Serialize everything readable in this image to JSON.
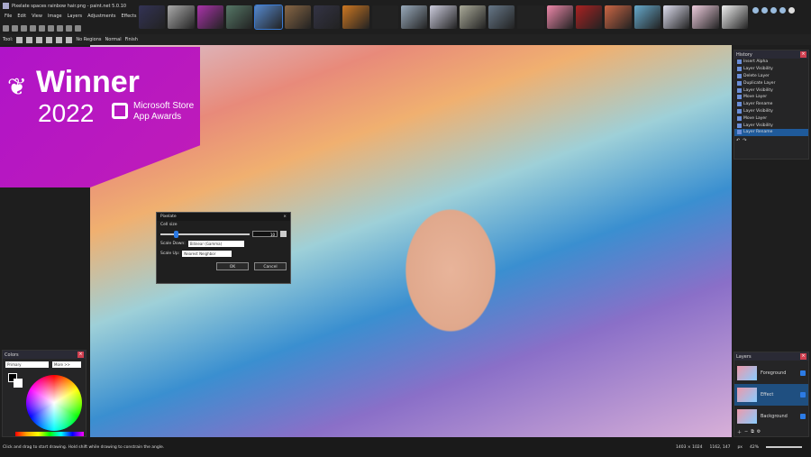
{
  "window": {
    "title": "Pixelate spaces rainbow hair.png - paint.net 5.0.10"
  },
  "menu": [
    "File",
    "Edit",
    "View",
    "Image",
    "Layers",
    "Adjustments",
    "Effects"
  ],
  "toolbar": {
    "tool_label": "Tool:",
    "selection_mode": "No Regions",
    "blend_mode": "Normal",
    "finish": "Finish"
  },
  "tabs": {
    "count": 21,
    "active_index": 4
  },
  "badge": {
    "title": "Winner",
    "year": "2022",
    "line1": "Microsoft Store",
    "line2": "App Awards"
  },
  "dialog": {
    "title": "Pixelate",
    "cell_size_label": "Cell size",
    "cell_size_value": "10",
    "cell_size_fraction": 0.15,
    "scale_down_label": "Scale Down:",
    "scale_down_value": "Bilinear (Gamma)",
    "scale_up_label": "Scale Up:",
    "scale_up_value": "Nearest Neighbor",
    "ok": "OK",
    "cancel": "Cancel"
  },
  "history": {
    "title": "History",
    "items": [
      "Insert Alpha",
      "Layer Visibility",
      "Delete Layer",
      "Duplicate Layer",
      "Layer Visibility",
      "Move Layer",
      "Layer Rename",
      "Layer Visibility",
      "Move Layer",
      "Layer Visibility",
      "Layer Rename"
    ],
    "selected": 10
  },
  "layers": {
    "title": "Layers",
    "items": [
      {
        "name": "Foreground"
      },
      {
        "name": "Effect"
      },
      {
        "name": "Background"
      }
    ],
    "selected": 1
  },
  "colors": {
    "title": "Colors",
    "primary_select": "Primary",
    "more_button": "More >>",
    "primary": "#000000",
    "secondary": "#ffffff"
  },
  "status": {
    "hint": "Click and drag to start drawing. Hold shift while drawing to constrain the angle.",
    "image_size": "1403 × 1024",
    "cursor": "1162, 147",
    "units": "px",
    "zoom": "42%"
  }
}
